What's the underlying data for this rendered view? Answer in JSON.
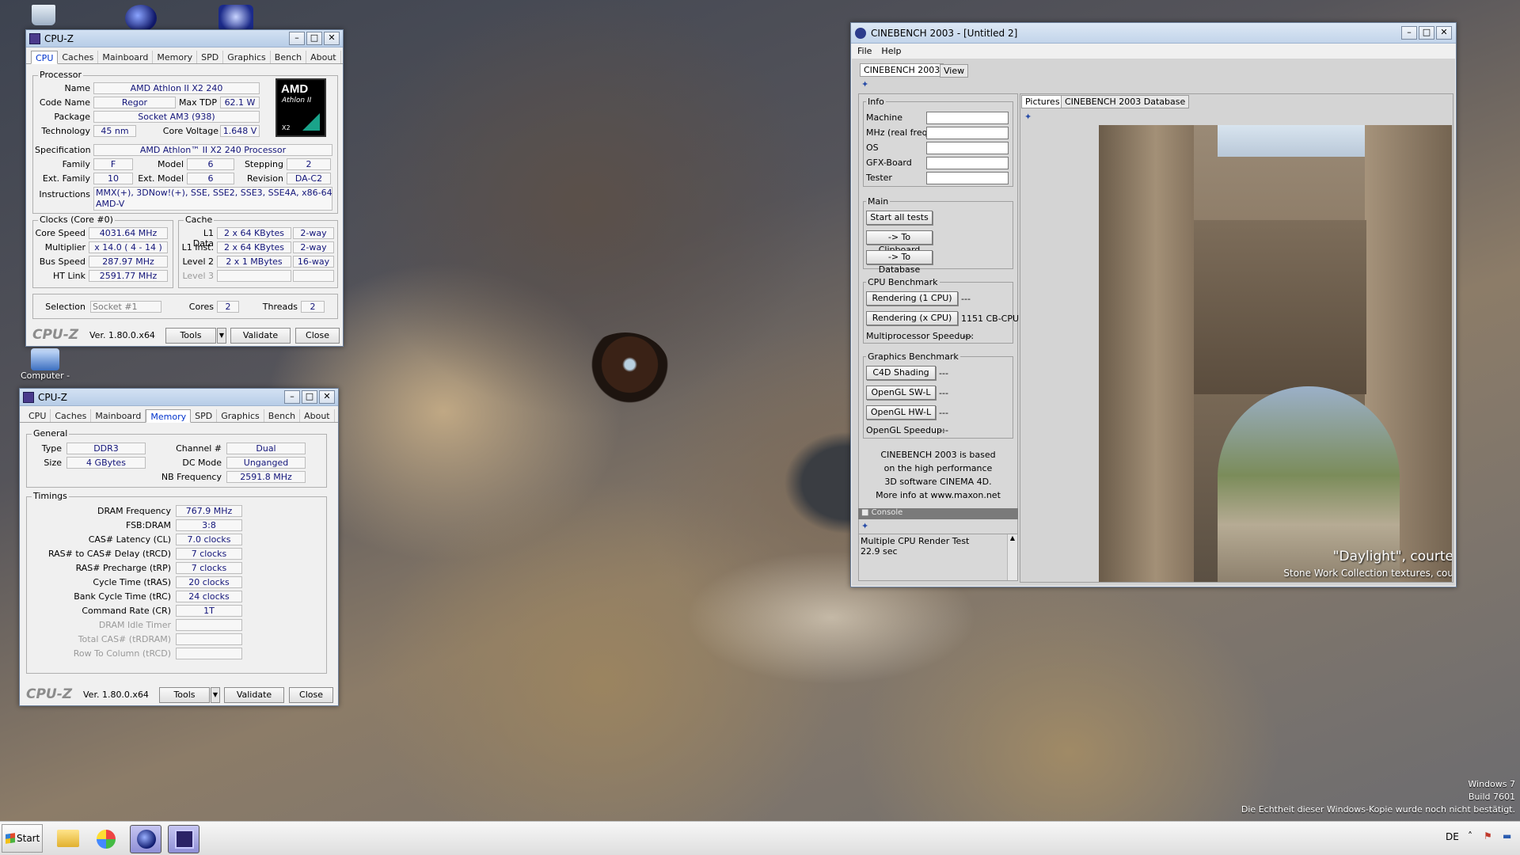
{
  "desktop": {
    "icons": [
      {
        "name": "recycle-bin"
      },
      {
        "name": "cinema4d"
      },
      {
        "name": "cpuz-shortcut"
      },
      {
        "name": "computer",
        "label": "Computer -"
      }
    ],
    "watermark": {
      "line1": "Windows 7",
      "line2": "Build 7601",
      "line3": "Die Echtheit dieser Windows-Kopie wurde noch nicht bestätigt."
    }
  },
  "cpuz_cpu": {
    "title": "CPU-Z",
    "tabs": [
      "CPU",
      "Caches",
      "Mainboard",
      "Memory",
      "SPD",
      "Graphics",
      "Bench",
      "About"
    ],
    "processor": {
      "group": "Processor",
      "name_label": "Name",
      "name": "AMD Athlon II X2 240",
      "codename_label": "Code Name",
      "codename": "Regor",
      "maxtdp_label": "Max TDP",
      "maxtdp": "62.1 W",
      "package_label": "Package",
      "package": "Socket AM3 (938)",
      "technology_label": "Technology",
      "technology": "45 nm",
      "corevoltage_label": "Core Voltage",
      "corevoltage": "1.648 V",
      "spec_label": "Specification",
      "spec": "AMD Athlon™ II X2 240 Processor",
      "family_label": "Family",
      "family": "F",
      "model_label": "Model",
      "model": "6",
      "stepping_label": "Stepping",
      "stepping": "2",
      "extfamily_label": "Ext. Family",
      "extfamily": "10",
      "extmodel_label": "Ext. Model",
      "extmodel": "6",
      "revision_label": "Revision",
      "revision": "DA-C2",
      "instructions_label": "Instructions",
      "instructions_line1": "MMX(+), 3DNow!(+), SSE, SSE2, SSE3, SSE4A, x86-64,",
      "instructions_line2": "AMD-V",
      "logo_line1": "AMD",
      "logo_line2": "Athlon II",
      "logo_line3": "X2"
    },
    "clocks": {
      "group": "Clocks (Core #0)",
      "corespeed_label": "Core Speed",
      "corespeed": "4031.64 MHz",
      "multiplier_label": "Multiplier",
      "multiplier": "x 14.0 ( 4 - 14 )",
      "busspeed_label": "Bus Speed",
      "busspeed": "287.97 MHz",
      "htlink_label": "HT Link",
      "htlink": "2591.77 MHz"
    },
    "cache": {
      "group": "Cache",
      "l1data_label": "L1 Data",
      "l1data": "2 x 64 KBytes",
      "l1data_way": "2-way",
      "l1inst_label": "L1 Inst.",
      "l1inst": "2 x 64 KBytes",
      "l1inst_way": "2-way",
      "l2_label": "Level 2",
      "l2": "2 x 1 MBytes",
      "l2_way": "16-way",
      "l3_label": "Level 3"
    },
    "selection_label": "Selection",
    "selection": "Socket #1",
    "cores_label": "Cores",
    "cores": "2",
    "threads_label": "Threads",
    "threads": "2",
    "logo": "CPU-Z",
    "version": "Ver. 1.80.0.x64",
    "tools": "Tools",
    "validate": "Validate",
    "close": "Close"
  },
  "cpuz_mem": {
    "title": "CPU-Z",
    "tabs": [
      "CPU",
      "Caches",
      "Mainboard",
      "Memory",
      "SPD",
      "Graphics",
      "Bench",
      "About"
    ],
    "general": {
      "group": "General",
      "type_label": "Type",
      "type": "DDR3",
      "size_label": "Size",
      "size": "4 GBytes",
      "channel_label": "Channel #",
      "channel": "Dual",
      "dcmode_label": "DC Mode",
      "dcmode": "Unganged",
      "nbfreq_label": "NB Frequency",
      "nbfreq": "2591.8 MHz"
    },
    "timings": {
      "group": "Timings",
      "rows": [
        {
          "label": "DRAM Frequency",
          "value": "767.9 MHz"
        },
        {
          "label": "FSB:DRAM",
          "value": "3:8"
        },
        {
          "label": "CAS# Latency (CL)",
          "value": "7.0 clocks"
        },
        {
          "label": "RAS# to CAS# Delay (tRCD)",
          "value": "7 clocks"
        },
        {
          "label": "RAS# Precharge (tRP)",
          "value": "7 clocks"
        },
        {
          "label": "Cycle Time (tRAS)",
          "value": "20 clocks"
        },
        {
          "label": "Bank Cycle Time (tRC)",
          "value": "24 clocks"
        },
        {
          "label": "Command Rate (CR)",
          "value": "1T"
        },
        {
          "label": "DRAM Idle Timer",
          "value": ""
        },
        {
          "label": "Total CAS# (tRDRAM)",
          "value": ""
        },
        {
          "label": "Row To Column (tRCD)",
          "value": ""
        }
      ]
    },
    "logo": "CPU-Z",
    "version": "Ver. 1.80.0.x64",
    "tools": "Tools",
    "validate": "Validate",
    "close": "Close"
  },
  "cinebench": {
    "title": "CINEBENCH 2003 - [Untitled 2]",
    "menu": {
      "file": "File",
      "help": "Help"
    },
    "tabs": {
      "main": "CINEBENCH 2003",
      "view": "View"
    },
    "info": {
      "group": "Info",
      "machine": "Machine",
      "mhz": "MHz (real freq.)",
      "os": "OS",
      "gfx": "GFX-Board",
      "tester": "Tester"
    },
    "main": {
      "group": "Main",
      "start_all": "Start all tests",
      "to_clipboard": "-> To Clipboard",
      "to_database": "-> To Database"
    },
    "cpu_bench": {
      "group": "CPU Benchmark",
      "render1": "Rendering (1 CPU)",
      "render1_result": "---",
      "renderx": "Rendering (x CPU)",
      "renderx_result": "1151 CB-CPU",
      "mp_label": "Multiprocessor Speedup:",
      "mp_value": "---"
    },
    "gfx_bench": {
      "group": "Graphics Benchmark",
      "c4d": "C4D Shading",
      "c4d_result": "---",
      "swl": "OpenGL SW-L",
      "swl_result": "---",
      "hwl": "OpenGL HW-L",
      "hwl_result": "---",
      "speedup_label": "OpenGL Speedup:",
      "speedup_value": "---"
    },
    "about": {
      "line1": "CINEBENCH 2003 is based",
      "line2": "on the high performance",
      "line3": "3D software CINEMA 4D.",
      "line4": "More info at www.maxon.net"
    },
    "console": {
      "title": "Console",
      "line1": "Multiple CPU Render Test",
      "line2": "22.9 sec"
    },
    "pictures": {
      "tab_pictures": "Pictures",
      "tab_db": "CINEBENCH 2003 Database",
      "caption1": "\"Daylight\", courte",
      "caption2": "Stone Work Collection textures, cou"
    }
  },
  "taskbar": {
    "start": "Start",
    "lang": "DE"
  }
}
